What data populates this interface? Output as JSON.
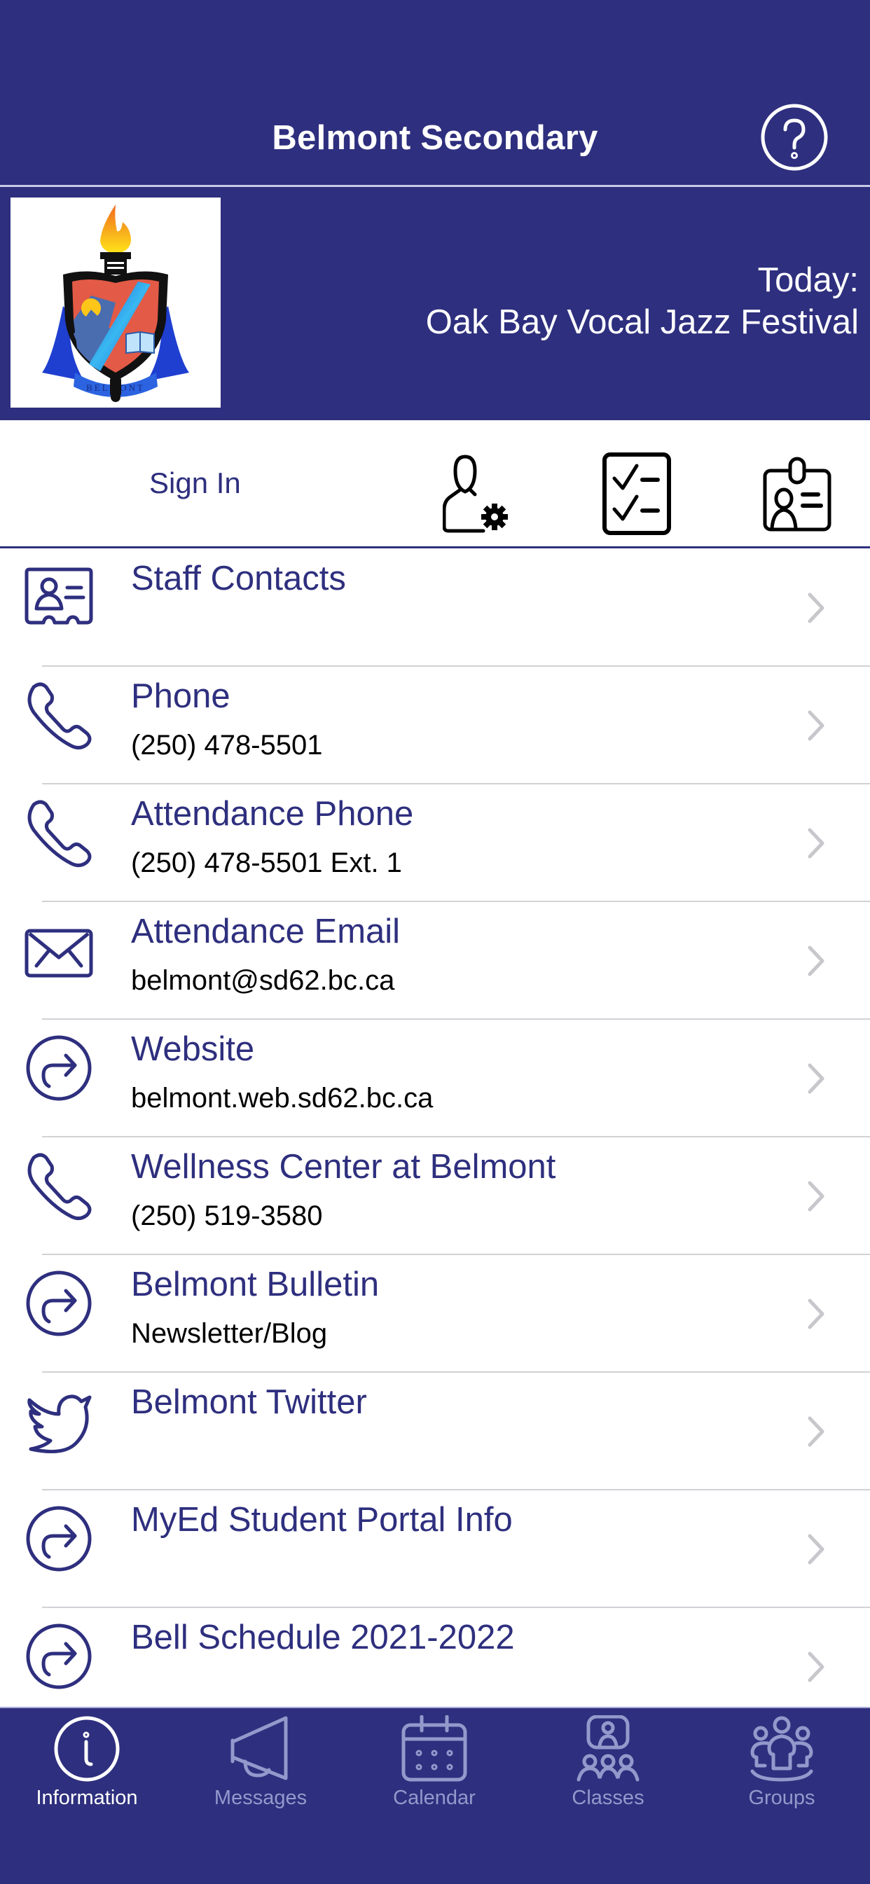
{
  "header": {
    "title": "Belmont Secondary",
    "help_icon": "help-circle-icon",
    "logo_alt": "Belmont school crest",
    "logo_banner_text": "BELMONT",
    "today_label": "Today:",
    "today_event": "Oak Bay Vocal Jazz Festival"
  },
  "account_bar": {
    "sign_in_label": "Sign In",
    "icons": [
      "user-settings-icon",
      "checklist-icon",
      "id-badge-icon"
    ]
  },
  "list": {
    "items": [
      {
        "title": "Staff Contacts",
        "subtitle": "",
        "icon": "contact-card-icon"
      },
      {
        "title": "Phone",
        "subtitle": "(250) 478-5501",
        "icon": "phone-icon"
      },
      {
        "title": "Attendance Phone",
        "subtitle": "(250) 478-5501 Ext. 1",
        "icon": "phone-icon"
      },
      {
        "title": "Attendance Email",
        "subtitle": "belmont@sd62.bc.ca",
        "icon": "mail-icon"
      },
      {
        "title": "Website",
        "subtitle": "belmont.web.sd62.bc.ca",
        "icon": "external-link-icon"
      },
      {
        "title": "Wellness Center at Belmont",
        "subtitle": "(250) 519-3580",
        "icon": "phone-icon"
      },
      {
        "title": "Belmont Bulletin",
        "subtitle": "Newsletter/Blog",
        "icon": "external-link-icon"
      },
      {
        "title": "Belmont Twitter",
        "subtitle": "",
        "icon": "twitter-icon"
      },
      {
        "title": "MyEd Student Portal Info",
        "subtitle": "",
        "icon": "external-link-icon"
      },
      {
        "title": "Bell Schedule 2021-2022",
        "subtitle": "",
        "icon": "external-link-icon"
      }
    ]
  },
  "tabbar": {
    "active_index": 0,
    "tabs": [
      {
        "label": "Information",
        "icon": "info-icon"
      },
      {
        "label": "Messages",
        "icon": "megaphone-icon"
      },
      {
        "label": "Calendar",
        "icon": "calendar-icon"
      },
      {
        "label": "Classes",
        "icon": "classes-icon"
      },
      {
        "label": "Groups",
        "icon": "groups-icon"
      }
    ]
  },
  "colors": {
    "brand": "#2E2F7E",
    "tab_inactive": "#9499CC",
    "tab_active": "#FFFFFF",
    "separator": "#D2D2D6",
    "chevron": "#C7C7CC"
  }
}
